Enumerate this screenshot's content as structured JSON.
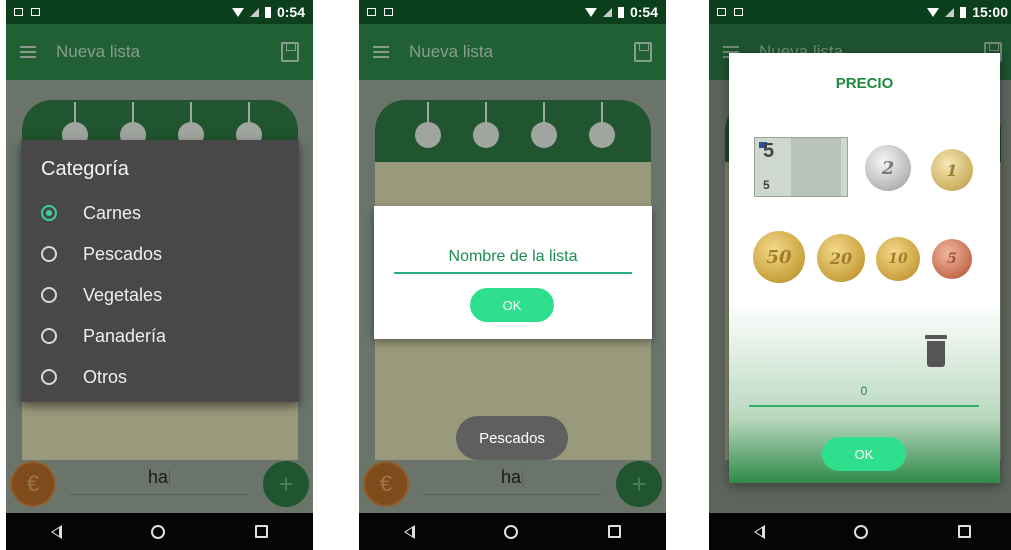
{
  "phone1": {
    "status": {
      "time": "0:54"
    },
    "appbar": {
      "title": "Nueva lista"
    },
    "dialog": {
      "title": "Categoría",
      "options": [
        "Carnes",
        "Pescados",
        "Vegetales",
        "Panadería",
        "Otros"
      ],
      "selected": "Carnes"
    },
    "bottom": {
      "input_value": "ha",
      "currency_icon": "€",
      "add_icon": "+"
    }
  },
  "phone2": {
    "status": {
      "time": "0:54"
    },
    "appbar": {
      "title": "Nueva lista"
    },
    "dialog": {
      "input_value": "Nombre de la lista",
      "ok_label": "OK"
    },
    "toast": "Pescados",
    "bottom": {
      "input_value": "ha",
      "currency_icon": "€",
      "add_icon": "+"
    }
  },
  "phone3": {
    "status": {
      "time": "15:00"
    },
    "appbar": {
      "title": "Nueva lista"
    },
    "dialog": {
      "title": "PRECIO",
      "bill": {
        "value": "5",
        "value_small": "5"
      },
      "coins_row1": [
        "2",
        "1"
      ],
      "coins_row2": [
        "50",
        "20",
        "10",
        "5"
      ],
      "price_value": "0",
      "ok_label": "OK"
    }
  },
  "colors": {
    "statusbar": "#0c3f1b",
    "appbar": "#1e7b3c",
    "accent": "#2ee08e",
    "dialog_dark": "#484848"
  }
}
